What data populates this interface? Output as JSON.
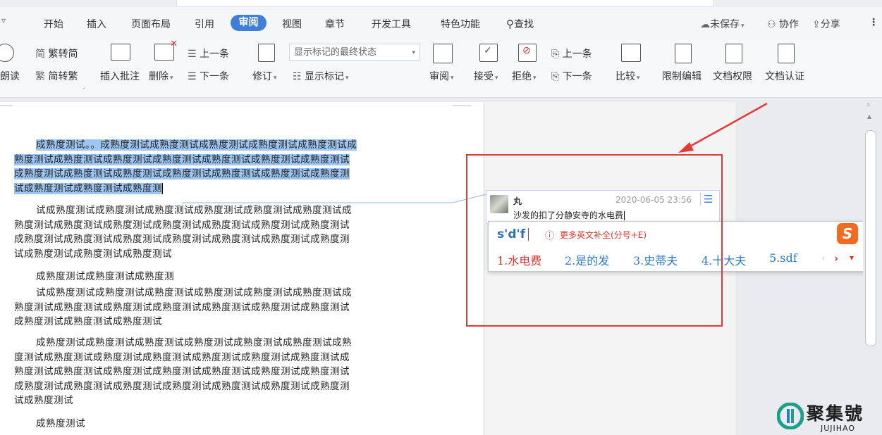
{
  "menu": {
    "items": [
      "开始",
      "插入",
      "页面布局",
      "引用",
      "视图",
      "章节",
      "开发工具",
      "特色功能"
    ],
    "active": "审阅",
    "search": "查找",
    "unsaved": "未保存",
    "collaborate": "协作",
    "share": "分享"
  },
  "ribbon": {
    "read_aloud": "朗读",
    "trad_simp": "繁转简",
    "simp_trad": "简转繁",
    "insert_comment": "插入批注",
    "delete": "删除",
    "prev_comment": "上一条",
    "next_comment": "下一条",
    "track_changes": "修订",
    "display_status": "显示标记的最终状态",
    "show_markup": "显示标记",
    "review": "审阅",
    "accept": "接受",
    "reject": "拒绝",
    "prev_change": "上一条",
    "next_change": "下一条",
    "compare": "比较",
    "restrict_edit": "限制编辑",
    "doc_permission": "文档权限",
    "doc_auth": "文档认证"
  },
  "document": {
    "para1_lines": [
      "成熟度测试。。成熟度测试成熟度测试成熟度测试成熟度测试成熟度测试成",
      "熟度测试成熟度测试成熟度测试成熟度测试成熟度测试成熟度测试成熟度测试",
      "成熟度测试成熟度测试成熟度测试成熟度测试成熟度测试成熟度测试成熟度测",
      "试成熟度测试成熟度测试成熟度测"
    ],
    "para2_lines": [
      "试成熟度测试成熟度测试成熟度测试成熟度测试成熟度测试成熟度测试成",
      "熟度测试成熟度测试成熟度测试成熟度测试成熟度测试成熟度测试成熟度测试",
      "成熟度测试成熟度测试成熟度测试成熟度测试成熟度测试成熟度测试成熟度测",
      "试成熟度测试成熟度测试成熟度测试"
    ],
    "para3_lines": [
      "成熟度测试成熟度测试成熟度测"
    ],
    "para4_lines": [
      "试成熟度测试成熟度测试成熟度测试成熟度测试成熟度测试成熟度测试成",
      "熟度测试成熟度测试成熟度测试成熟度测试成熟度测试成熟度测试成熟度测试",
      "成熟度测试成熟度测试成熟度测试"
    ],
    "para5_lines": [
      "成熟度测试成熟度测试成熟度测试成熟度测试成熟度测试成熟度测试成熟",
      "度测试成熟度测试成熟度测试成熟度测试成熟度测试成熟度测试成熟度测试成",
      "熟度测试成熟度测试成熟度测试成熟度测试成熟度测试成熟度测试成熟度测试",
      "成熟度测试成熟度测试成熟度测试成熟度测试成熟度测试成熟度测试成熟度测",
      "试成熟度测试"
    ],
    "para6_lines": [
      "成熟度测试"
    ]
  },
  "comment": {
    "author": "丸",
    "timestamp": "2020-06-05 23:56",
    "text": "沙发的扣了分静安寺的水电费"
  },
  "ime": {
    "input": "s'd'f",
    "hint": "更多英文补全(分号+E)",
    "candidates": [
      "1.水电费",
      "2.是的发",
      "3.史蒂夫",
      "4.十大夫",
      "5.sdf"
    ]
  },
  "watermark": {
    "brand": "聚集號",
    "latin": "JUJIHAO"
  },
  "colors": {
    "accent": "#3f7fdc",
    "selection": "#9dc6f2",
    "annotation_red": "#e53935",
    "ime_red": "#d9342b",
    "ime_blue": "#2d7cc4"
  }
}
